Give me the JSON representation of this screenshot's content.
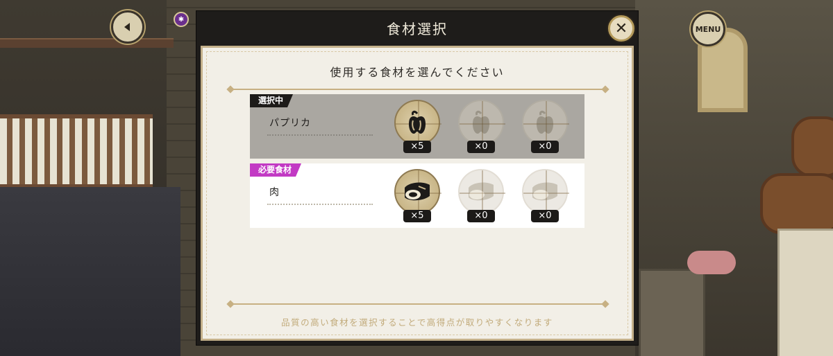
{
  "header": {
    "title": "食材選択",
    "close_icon": "close-icon",
    "menu_label": "MENU",
    "back_icon": "chevron-left-icon"
  },
  "panel": {
    "subtitle": "使用する食材を選んでください",
    "note": "品質の高い食材を選択することで高得点が取りやすくなります"
  },
  "rows": [
    {
      "tag": "選択中",
      "tag_color": "#1d1b19",
      "ingredient": "パプリカ",
      "icon": "bell-pepper-icon",
      "slots": [
        {
          "count": "×5",
          "active": true
        },
        {
          "count": "×0",
          "active": false
        },
        {
          "count": "×0",
          "active": false
        }
      ]
    },
    {
      "tag": "必要食材",
      "tag_color": "#c23ac4",
      "ingredient": "肉",
      "icon": "meat-icon",
      "slots": [
        {
          "count": "×5",
          "active": true
        },
        {
          "count": "×0",
          "active": false
        },
        {
          "count": "×0",
          "active": false
        }
      ]
    }
  ],
  "colors": {
    "accent_gold": "#c7b083",
    "panel_bg": "#f2efe7",
    "selected_row_bg": "#aaa7a1",
    "required_tag": "#c23ac4"
  }
}
